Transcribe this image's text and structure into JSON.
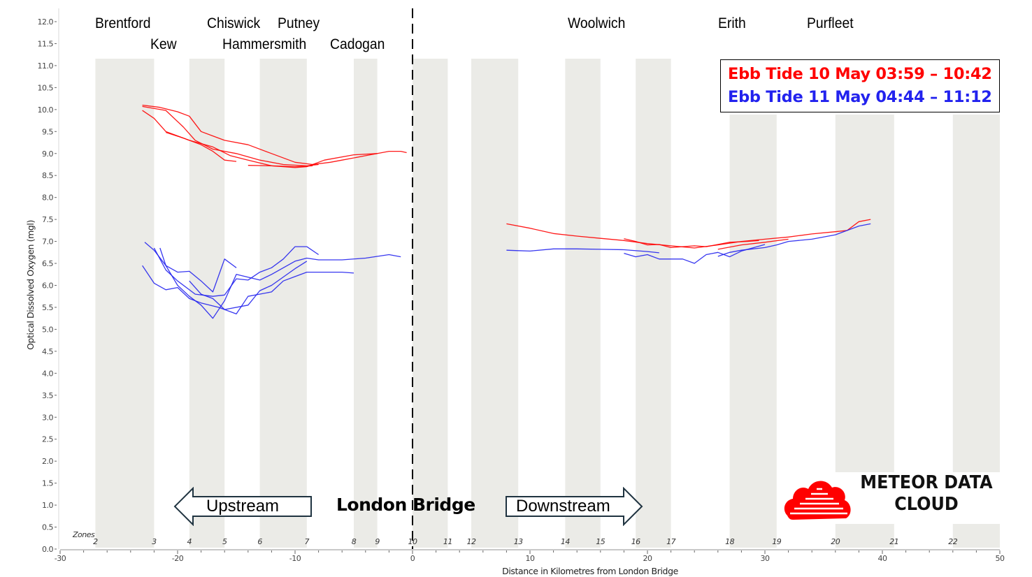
{
  "chart_data": {
    "type": "line",
    "title": "",
    "xlabel": "Distance in Kilometres from London Bridge",
    "ylabel": "Optical Dissolved Oxygen (mgl)",
    "xlim": [
      -30,
      50
    ],
    "ylim": [
      0,
      12
    ],
    "xticks": [
      -30,
      -20,
      -10,
      0,
      10,
      20,
      30,
      40,
      50
    ],
    "yticks": [
      "0.0",
      "0.5",
      "1.0",
      "1.5",
      "2.0",
      "2.5",
      "3.0",
      "3.5",
      "4.0",
      "4.5",
      "5.0",
      "5.5",
      "6.0",
      "6.5",
      "7.0",
      "7.5",
      "8.0",
      "8.5",
      "9.0",
      "9.5",
      "10.0",
      "10.5",
      "11.0",
      "11.5",
      "12.0"
    ],
    "grid": false,
    "legend_position": "top-right",
    "zones_label": "Zones",
    "zones": [
      {
        "label": "2",
        "x": -27
      },
      {
        "label": "3",
        "x": -22
      },
      {
        "label": "4",
        "x": -19
      },
      {
        "label": "5",
        "x": -16
      },
      {
        "label": "6",
        "x": -13
      },
      {
        "label": "7",
        "x": -9
      },
      {
        "label": "8",
        "x": -5
      },
      {
        "label": "9",
        "x": -3
      },
      {
        "label": "10",
        "x": 0
      },
      {
        "label": "11",
        "x": 3
      },
      {
        "label": "12",
        "x": 5
      },
      {
        "label": "13",
        "x": 9
      },
      {
        "label": "14",
        "x": 13
      },
      {
        "label": "15",
        "x": 16
      },
      {
        "label": "16",
        "x": 19
      },
      {
        "label": "17",
        "x": 22
      },
      {
        "label": "18",
        "x": 27
      },
      {
        "label": "19",
        "x": 31
      },
      {
        "label": "20",
        "x": 36
      },
      {
        "label": "21",
        "x": 41
      },
      {
        "label": "22",
        "x": 46
      }
    ],
    "shaded_bands": [
      [
        -27,
        -22
      ],
      [
        -19,
        -16
      ],
      [
        -13,
        -9
      ],
      [
        -5,
        -3
      ],
      [
        0,
        3
      ],
      [
        5,
        9
      ],
      [
        13,
        16
      ],
      [
        19,
        22
      ],
      [
        27,
        31
      ],
      [
        36,
        41
      ],
      [
        46,
        50
      ]
    ],
    "reference_line": {
      "x": 0,
      "label": "London Bridge"
    },
    "locations": [
      {
        "name": "Brentford",
        "x": -27,
        "row": 1
      },
      {
        "name": "Kew",
        "x": -22.3,
        "row": 2
      },
      {
        "name": "Chiswick",
        "x": -17.5,
        "row": 1
      },
      {
        "name": "Hammersmith",
        "x": -16.2,
        "row": 2
      },
      {
        "name": "Putney",
        "x": -11.5,
        "row": 1
      },
      {
        "name": "Cadogan",
        "x": -7,
        "row": 2
      },
      {
        "name": "Woolwich",
        "x": 13.2,
        "row": 1
      },
      {
        "name": "Erith",
        "x": 26,
        "row": 1
      },
      {
        "name": "Purfleet",
        "x": 33.6,
        "row": 1
      }
    ],
    "series": [
      {
        "name": "Ebb Tide 10 May 03:59 – 10:42",
        "color": "#ff0000",
        "runs": [
          [
            [
              -23,
              10.1
            ],
            [
              -21.5,
              10.05
            ],
            [
              -20,
              9.95
            ],
            [
              -19,
              9.85
            ],
            [
              -18,
              9.5
            ],
            [
              -17,
              9.4
            ],
            [
              -16,
              9.3
            ],
            [
              -14,
              9.2
            ],
            [
              -12,
              9.0
            ],
            [
              -10,
              8.8
            ],
            [
              -8.5,
              8.75
            ],
            [
              -7,
              8.8
            ],
            [
              -6,
              8.85
            ],
            [
              -4,
              8.95
            ],
            [
              -2,
              9.05
            ],
            [
              -1,
              9.05
            ],
            [
              -0.5,
              9.02
            ]
          ],
          [
            [
              -23,
              10.07
            ],
            [
              -21,
              9.98
            ],
            [
              -19.5,
              9.6
            ],
            [
              -18.5,
              9.3
            ],
            [
              -17,
              9.1
            ],
            [
              -15,
              9.0
            ],
            [
              -13,
              8.85
            ],
            [
              -11,
              8.75
            ],
            [
              -9,
              8.72
            ],
            [
              -8,
              8.75
            ]
          ],
          [
            [
              -23,
              9.98
            ],
            [
              -22,
              9.8
            ],
            [
              -21,
              9.5
            ],
            [
              -20,
              9.4
            ],
            [
              -19,
              9.3
            ],
            [
              -17,
              9.15
            ],
            [
              -15.5,
              8.95
            ],
            [
              -14,
              8.85
            ],
            [
              -12,
              8.72
            ],
            [
              -10,
              8.7
            ],
            [
              -8.5,
              8.72
            ]
          ],
          [
            [
              -21,
              9.48
            ],
            [
              -19.5,
              9.35
            ],
            [
              -18,
              9.2
            ],
            [
              -17,
              9.05
            ],
            [
              -16,
              8.85
            ],
            [
              -15,
              8.82
            ]
          ],
          [
            [
              -14,
              8.73
            ],
            [
              -12,
              8.72
            ],
            [
              -10,
              8.68
            ],
            [
              -9,
              8.7
            ],
            [
              -7.5,
              8.85
            ],
            [
              -5,
              8.97
            ],
            [
              -3,
              9.0
            ]
          ],
          [
            [
              8,
              7.4
            ],
            [
              10,
              7.3
            ],
            [
              12,
              7.18
            ],
            [
              14,
              7.12
            ],
            [
              16,
              7.07
            ],
            [
              18,
              7.02
            ],
            [
              20,
              6.95
            ],
            [
              22,
              6.9
            ],
            [
              24,
              6.85
            ],
            [
              26,
              6.92
            ],
            [
              28,
              7.0
            ],
            [
              30,
              7.05
            ],
            [
              32,
              7.1
            ],
            [
              34,
              7.17
            ],
            [
              36,
              7.22
            ],
            [
              37,
              7.25
            ],
            [
              38,
              7.45
            ],
            [
              39,
              7.5
            ]
          ],
          [
            [
              18,
              7.06
            ],
            [
              19,
              7.0
            ],
            [
              20,
              6.92
            ],
            [
              21,
              6.93
            ],
            [
              22,
              6.86
            ],
            [
              24,
              6.9
            ],
            [
              25,
              6.88
            ],
            [
              27,
              6.98
            ],
            [
              28.5,
              7.0
            ],
            [
              29.5,
              7.02
            ]
          ],
          [
            [
              26,
              6.82
            ],
            [
              28,
              6.92
            ],
            [
              30,
              6.98
            ],
            [
              32,
              7.05
            ]
          ]
        ]
      },
      {
        "name": "Ebb Tide 11 May 04:44 – 11:12",
        "color": "#2222ee",
        "runs": [
          [
            [
              -23,
              6.45
            ],
            [
              -22,
              6.05
            ],
            [
              -21,
              5.9
            ],
            [
              -20,
              5.95
            ],
            [
              -19,
              5.7
            ],
            [
              -18,
              5.6
            ],
            [
              -16.5,
              5.5
            ],
            [
              -15,
              5.35
            ],
            [
              -14,
              5.75
            ],
            [
              -12,
              5.85
            ],
            [
              -11,
              6.1
            ],
            [
              -10,
              6.2
            ],
            [
              -9,
              6.3
            ],
            [
              -6,
              6.3
            ],
            [
              -5,
              6.28
            ]
          ],
          [
            [
              -22.8,
              6.98
            ],
            [
              -22,
              6.8
            ],
            [
              -21,
              6.45
            ],
            [
              -20,
              6.3
            ],
            [
              -19,
              6.32
            ],
            [
              -18,
              6.1
            ],
            [
              -17,
              5.85
            ],
            [
              -16,
              6.6
            ],
            [
              -15,
              6.4
            ]
          ],
          [
            [
              -22,
              6.85
            ],
            [
              -21,
              6.35
            ],
            [
              -20,
              6.1
            ],
            [
              -18.5,
              5.8
            ],
            [
              -17,
              5.75
            ],
            [
              -16,
              5.78
            ],
            [
              -15,
              6.15
            ],
            [
              -14,
              6.12
            ],
            [
              -13,
              6.3
            ],
            [
              -12,
              6.4
            ],
            [
              -11,
              6.6
            ],
            [
              -10,
              6.88
            ],
            [
              -9,
              6.88
            ],
            [
              -8,
              6.7
            ]
          ],
          [
            [
              -21.5,
              6.85
            ],
            [
              -21,
              6.45
            ],
            [
              -20,
              6.0
            ],
            [
              -19,
              5.75
            ],
            [
              -18,
              5.55
            ],
            [
              -17,
              5.25
            ],
            [
              -16,
              5.65
            ],
            [
              -15,
              6.25
            ],
            [
              -13,
              6.12
            ],
            [
              -12,
              6.25
            ],
            [
              -10,
              6.55
            ],
            [
              -9,
              6.62
            ],
            [
              -8,
              6.58
            ],
            [
              -6,
              6.58
            ],
            [
              -4,
              6.62
            ],
            [
              -2,
              6.7
            ],
            [
              -1,
              6.65
            ]
          ],
          [
            [
              -19,
              6.1
            ],
            [
              -18,
              5.8
            ],
            [
              -17,
              5.7
            ],
            [
              -16,
              5.45
            ],
            [
              -14,
              5.55
            ],
            [
              -13,
              5.88
            ],
            [
              -12,
              6.0
            ],
            [
              -10,
              6.38
            ],
            [
              -9,
              6.55
            ]
          ],
          [
            [
              8,
              6.8
            ],
            [
              9,
              6.79
            ],
            [
              10,
              6.78
            ],
            [
              12,
              6.83
            ],
            [
              14,
              6.83
            ],
            [
              16,
              6.82
            ],
            [
              18,
              6.81
            ],
            [
              20,
              6.77
            ],
            [
              21,
              6.74
            ]
          ],
          [
            [
              18,
              6.73
            ],
            [
              19,
              6.65
            ],
            [
              20,
              6.7
            ],
            [
              21,
              6.6
            ],
            [
              23,
              6.6
            ],
            [
              24,
              6.5
            ],
            [
              25,
              6.7
            ],
            [
              26,
              6.75
            ],
            [
              27,
              6.65
            ],
            [
              28,
              6.78
            ],
            [
              30,
              6.93
            ]
          ],
          [
            [
              26,
              6.66
            ],
            [
              27,
              6.75
            ],
            [
              28,
              6.8
            ],
            [
              30,
              6.86
            ],
            [
              31,
              6.92
            ],
            [
              32,
              7.0
            ],
            [
              34,
              7.05
            ],
            [
              36,
              7.15
            ],
            [
              37,
              7.25
            ],
            [
              38,
              7.35
            ],
            [
              39,
              7.4
            ]
          ]
        ]
      }
    ]
  },
  "legend": {
    "entries": [
      {
        "label": "Ebb Tide 10 May 03:59 – 10:42",
        "color": "#ff0000"
      },
      {
        "label": "Ebb Tide 11 May 04:44 – 11:12",
        "color": "#2222ee"
      }
    ]
  },
  "annotations": {
    "upstream": "Upstream",
    "downstream": "Downstream",
    "london_bridge": "London Bridge"
  },
  "logo": {
    "line1": "METEOR DATA",
    "line2": "CLOUD",
    "icon": "cloud-icon",
    "color": "#ff0000"
  }
}
